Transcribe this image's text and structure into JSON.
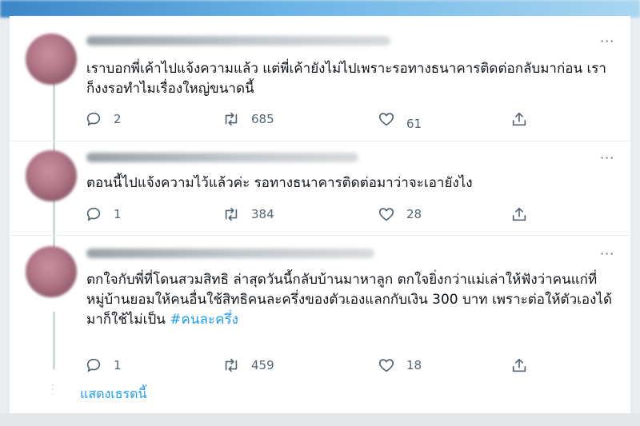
{
  "tweets": [
    {
      "text": "เราบอกพี่เค้าไปแจ้งความแล้ว แต่พี่เค้ายังไม่ไปเพราะรอทางธนาคารติดต่อกลับมาก่อน เราก็งงรอทำไมเรื่องใหญ่ขนาดนี้",
      "replies": "2",
      "retweets": "685",
      "likes": "61"
    },
    {
      "text": "ตอนนี้ไปแจ้งความไว้แล้วค่ะ รอทางธนาคารติดต่อมาว่าจะเอายังไง",
      "replies": "1",
      "retweets": "384",
      "likes": "28"
    },
    {
      "text": "ตกใจกับพี่ที่โดนสวมสิทธิ ล่าสุดวันนี้กลับบ้านมาหาลูก ตกใจยิ่งกว่าแม่เล่าให้ฟังว่าคนแก่ที่หมู่บ้านยอมให้คนอื่นใช้สิทธิคนละครึ่งของตัวเองแลกกับเงิน 300 บาท เพราะต่อให้ตัวเองได้มาก็ใช้ไม่เป็น ",
      "hashtag": "#คนละครึ่ง",
      "replies": "1",
      "retweets": "459",
      "likes": "18"
    }
  ],
  "more_icon": "···",
  "show_thread": "แสดงเธรดนี้",
  "colors": {
    "accent": "#1d9bf0",
    "muted": "#536471",
    "text": "#0f1419"
  }
}
